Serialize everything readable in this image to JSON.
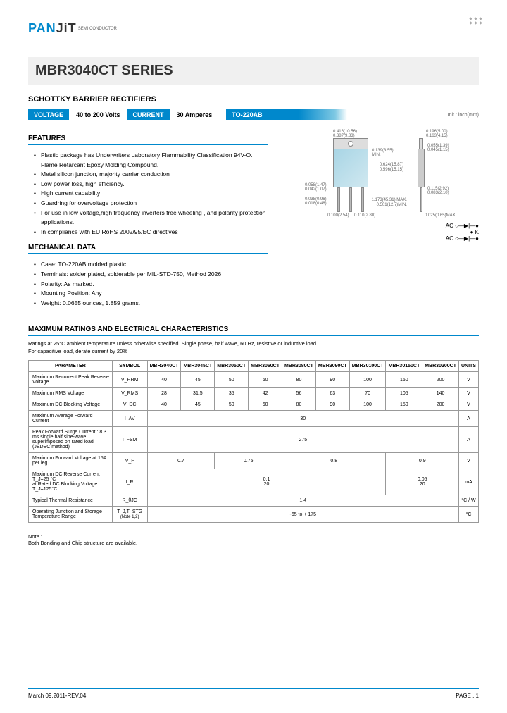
{
  "logo": {
    "pan": "PAN",
    "jit": "JiT",
    "sub": "SEMI\nCONDUCTOR"
  },
  "title": "MBR3040CT SERIES",
  "subtitle": "SCHOTTKY BARRIER RECTIFIERS",
  "specs": {
    "voltage_label": "VOLTAGE",
    "voltage_value": "40 to 200 Volts",
    "current_label": "CURRENT",
    "current_value": "30 Amperes",
    "package": "TO-220AB",
    "unit": "Unit : inch(mm)"
  },
  "features": {
    "heading": "FEATURES",
    "items": [
      "Plastic package has Underwriters Laboratory Flammability Classification 94V-O. Flame Retarcant Epoxy Molding Compound.",
      "Metal silicon junction, majority carrier conduction",
      "Low power loss, high efficiency.",
      "High current capability",
      "Guardring for overvoltage protection",
      "For use in low voltage,high frequency inverters free wheeling , and polarity protection applications.",
      "In compliance with EU RoHS 2002/95/EC directives"
    ]
  },
  "mechanical": {
    "heading": "MECHANICAL DATA",
    "items": [
      "Case: TO-220AB molded plastic",
      "Terminals: solder plated, solderable per MIL-STD-750, Method 2026",
      "Polarity: As marked.",
      "Mounting Position: Any",
      "Weight: 0.0655 ounces, 1.859 grams."
    ]
  },
  "dimensions": {
    "d1": "0.416(10.56)",
    "d2": "0.387(9.83)",
    "d3": "0.139(3.55) MIN.",
    "d4": "0.196(5.00)",
    "d5": "0.163(4.15)",
    "d6": "0.055(1.39)",
    "d7": "0.045(1.15)",
    "d8": "0.624(15.87)",
    "d9": "0.596(15.15)",
    "d10": "0.058(1.47)",
    "d11": "0.042(1.07)",
    "d12": "0.115(2.92)",
    "d13": "0.083(2.10)",
    "d14": "0.038(0.96)",
    "d15": "0.018(0.46)",
    "d16": "0.025(0.65)MAX.",
    "d17": "0.100(2.54)",
    "d18": "0.110(2.80)",
    "d19": "1.173(45.31) MAX.",
    "d20": "0.501(12.7)MIN.",
    "ac": "AC",
    "ko": "K"
  },
  "ratings": {
    "heading": "MAXIMUM RATINGS AND ELECTRICAL CHARACTERISTICS",
    "sub1": "Ratings at 25°C ambient temperature unless otherwise specified. Single phase, half wave, 60 Hz, resistive or inductive load.",
    "sub2": "For capacitive load, derate current by 20%",
    "headers": [
      "PARAMETER",
      "SYMBOL",
      "MBR3040CT",
      "MBR3045CT",
      "MBR3050CT",
      "MBR3060CT",
      "MBR3080CT",
      "MBR3090CT",
      "MBR30100CT",
      "MBR30150CT",
      "MBR30200CT",
      "UNITS"
    ],
    "rows": [
      {
        "param": "Maximum Recurrent Peak Reverse Voltage",
        "symbol": "V_RRM",
        "vals": [
          "40",
          "45",
          "50",
          "60",
          "80",
          "90",
          "100",
          "150",
          "200"
        ],
        "unit": "V"
      },
      {
        "param": "Maximum RMS Voltage",
        "symbol": "V_RMS",
        "vals": [
          "28",
          "31.5",
          "35",
          "42",
          "56",
          "63",
          "70",
          "105",
          "140"
        ],
        "unit": "V"
      },
      {
        "param": "Maximum DC Blocking Voltage",
        "symbol": "V_DC",
        "vals": [
          "40",
          "45",
          "50",
          "60",
          "80",
          "90",
          "100",
          "150",
          "200"
        ],
        "unit": "V"
      }
    ],
    "merged_rows": [
      {
        "param": "Maximum Average Forward Current",
        "symbol": "I_AV",
        "merged_val": "30",
        "unit": "A"
      },
      {
        "param": "Peak Forward Surge Current : 8.3 ms single half sine-wave superimposed on rated load (JEDEC method)",
        "symbol": "I_FSM",
        "merged_val": "275",
        "unit": "A"
      }
    ],
    "vf_row": {
      "param": "Maximum Forward Voltage at 15A per leg",
      "symbol": "V_F",
      "groups": [
        "0.7",
        "0.75",
        "0.8",
        "0.9"
      ],
      "unit": "V"
    },
    "ir_row": {
      "param": "Maximum DC Reverse Current       T_J=25 °C\nat Rated DC Blocking Voltage       T_J=125°C",
      "symbol": "I_R",
      "groups": [
        "0.1\n20",
        "0.05\n20"
      ],
      "unit": "mA"
    },
    "rth_row": {
      "param": "Typical Thermal Resistance",
      "symbol": "R_θJC",
      "merged_val": "1.4",
      "unit": "°C / W"
    },
    "temp_row": {
      "param": "Operating Junction and Storage Temperature Range",
      "symbol": "T_J,T_STG",
      "note": "(Note 1,2)",
      "merged_val": "-65 to + 175",
      "unit": "°C"
    }
  },
  "note": {
    "label": "Note :",
    "text": "Both Bonding and Chip structure are available."
  },
  "footer": {
    "date": "March 09,2011-REV.04",
    "page": "PAGE .  1"
  }
}
